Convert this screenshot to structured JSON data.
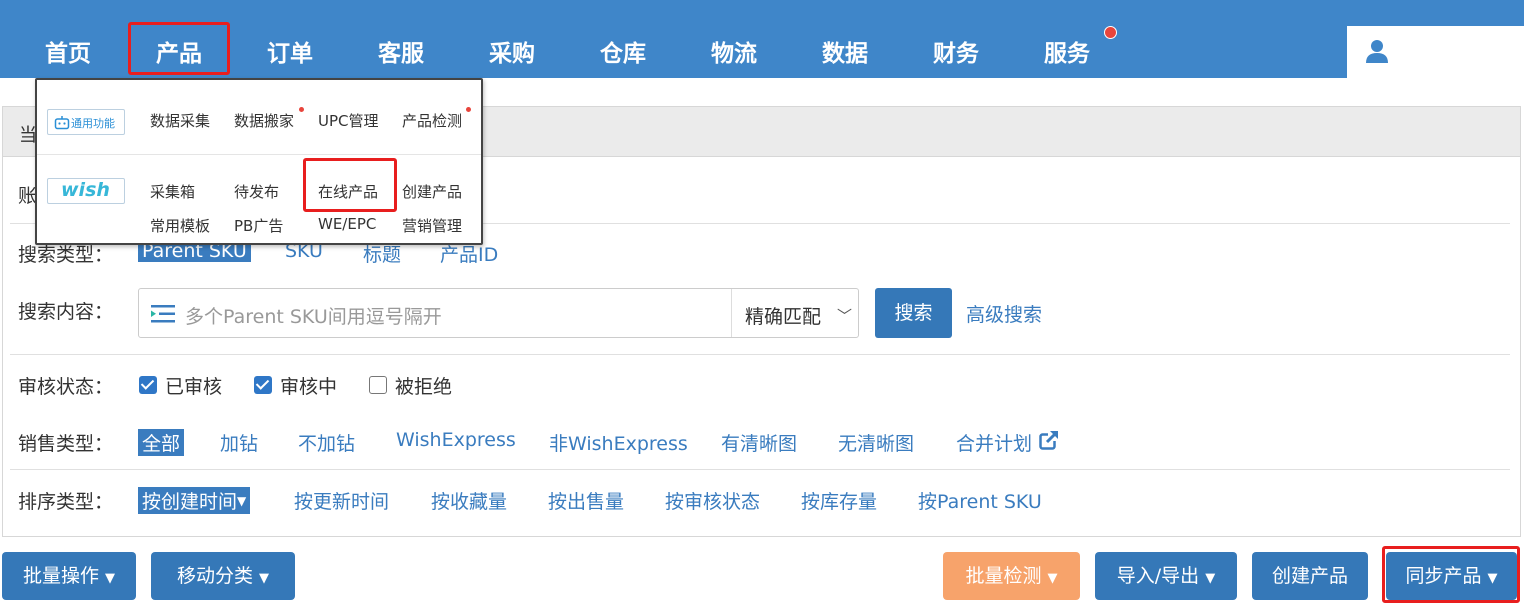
{
  "nav": {
    "items": [
      "首页",
      "产品",
      "订单",
      "客服",
      "采购",
      "仓库",
      "物流",
      "数据",
      "财务",
      "服务"
    ],
    "active": "产品"
  },
  "panel": {
    "header_partial": "当",
    "account_partial": "账"
  },
  "search_type": {
    "label": "搜索类型：",
    "options": [
      "Parent SKU",
      "SKU",
      "标题",
      "产品ID"
    ]
  },
  "search_content": {
    "label": "搜索内容：",
    "placeholder": "多个Parent SKU间用逗号隔开",
    "match_mode": "精确匹配",
    "search_button": "搜索",
    "advanced_search": "高级搜索"
  },
  "review_status": {
    "label": "审核状态：",
    "options": [
      {
        "label": "已审核",
        "checked": true
      },
      {
        "label": "审核中",
        "checked": true
      },
      {
        "label": "被拒绝",
        "checked": false
      }
    ]
  },
  "sales_type": {
    "label": "销售类型：",
    "options": [
      "全部",
      "加钻",
      "不加钻",
      "WishExpress",
      "非WishExpress",
      "有清晰图",
      "无清晰图",
      "合并计划"
    ]
  },
  "sort_type": {
    "label": "排序类型：",
    "options": [
      "按创建时间",
      "按更新时间",
      "按收藏量",
      "按出售量",
      "按审核状态",
      "按库存量",
      "按Parent SKU"
    ]
  },
  "bottom_buttons": {
    "batch_ops": "批量操作",
    "move_category": "移动分类",
    "batch_check": "批量检测",
    "import_export": "导入/导出",
    "create_product": "创建产品",
    "sync_product": "同步产品"
  },
  "dropdown": {
    "general_tag": "通用功能",
    "wish_tag": "wish",
    "general_items": [
      "数据采集",
      "数据搬家",
      "UPC管理",
      "产品检测"
    ],
    "wish_items_row1": [
      "采集箱",
      "待发布",
      "在线产品",
      "创建产品"
    ],
    "wish_items_row2": [
      "常用模板",
      "PB广告",
      "WE/EPC",
      "营销管理"
    ]
  },
  "colors": {
    "nav_bg": "#3f86c9",
    "primary": "#3578b8",
    "link": "#3a7cbf",
    "orange": "#f7a36b",
    "highlight": "#e81e1e"
  }
}
